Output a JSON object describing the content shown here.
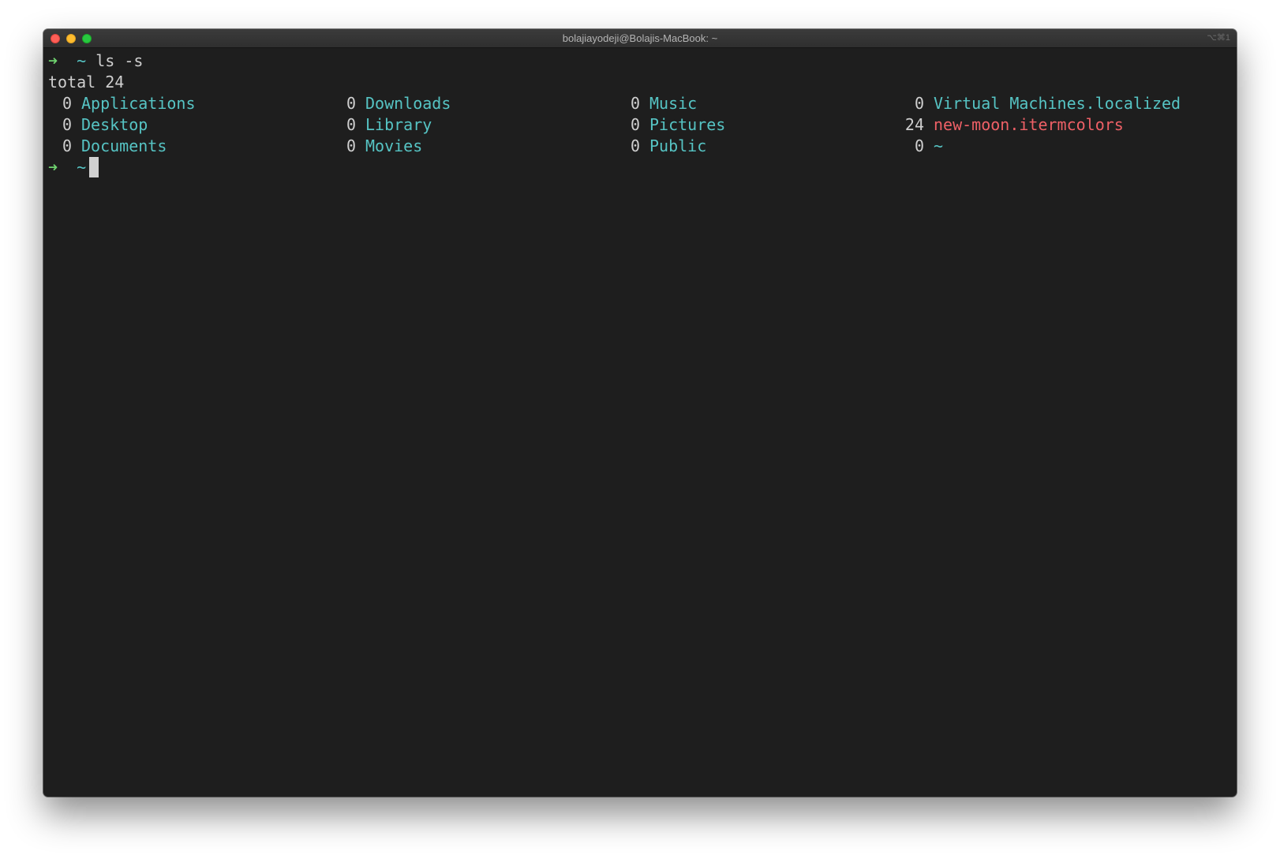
{
  "window": {
    "title": "bolajiayodeji@Bolajis-MacBook: ~",
    "shortcut": "⌥⌘1"
  },
  "terminal": {
    "prompt_arrow": "➜",
    "prompt_dir": "~",
    "command": "ls -s",
    "total_line": "total 24",
    "rows": [
      [
        {
          "size": "0",
          "name": "Applications"
        },
        {
          "size": "0",
          "name": "Downloads"
        },
        {
          "size": "0",
          "name": "Music"
        },
        {
          "size": "0",
          "name": "Virtual Machines.localized"
        }
      ],
      [
        {
          "size": "0",
          "name": "Desktop"
        },
        {
          "size": "0",
          "name": "Library"
        },
        {
          "size": "0",
          "name": "Pictures"
        },
        {
          "size": "24",
          "name": "new-moon.itermcolors"
        }
      ],
      [
        {
          "size": "0",
          "name": "Documents"
        },
        {
          "size": "0",
          "name": "Movies"
        },
        {
          "size": "0",
          "name": "Public"
        },
        {
          "size": "0",
          "name": "~"
        }
      ]
    ]
  },
  "colors": {
    "background": "#1e1e1e",
    "directory": "#56c4c4",
    "file": "#ee6066",
    "prompt_arrow": "#6fd36f",
    "text": "#cfcfcf"
  }
}
